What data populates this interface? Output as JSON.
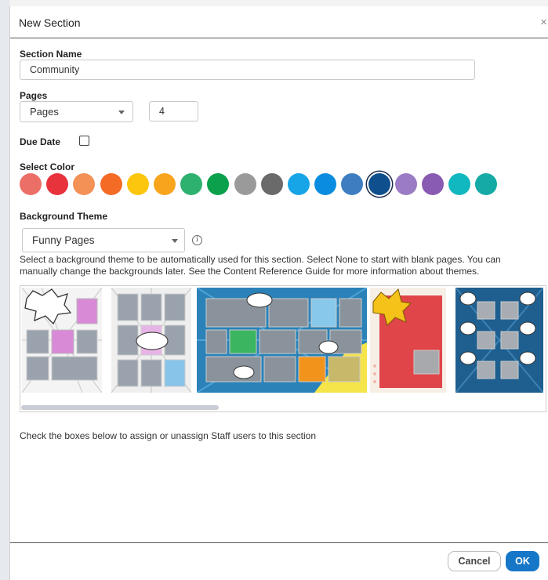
{
  "dialog": {
    "title": "New Section",
    "close_glyph": "×"
  },
  "section_name": {
    "label": "Section Name",
    "value": "Community"
  },
  "pages": {
    "label": "Pages",
    "selected": "Pages",
    "count": "4"
  },
  "due_date": {
    "label": "Due Date",
    "checked": false
  },
  "colors": {
    "label": "Select Color",
    "selected_index": 14,
    "swatches": [
      "#ec6f67",
      "#e8323c",
      "#f49157",
      "#f46b26",
      "#fbc60d",
      "#f8a51d",
      "#2eb16f",
      "#0ba04b",
      "#9a9a9a",
      "#6a6a6a",
      "#17a5e8",
      "#0a8ce0",
      "#3e7ec0",
      "#0f4f8e",
      "#9b7bc4",
      "#8a5bb2",
      "#12b8bf",
      "#16aaa6"
    ]
  },
  "background_theme": {
    "label": "Background Theme",
    "selected": "Funny Pages",
    "info_icon": "info-icon",
    "description": "Select a background theme to be automatically used for this section. Select None to start with blank pages. You can manually change the backgrounds later. See the Content Reference Guide for more information about themes."
  },
  "assign_text": "Check the boxes below to assign or unassign Staff users to this section",
  "footer": {
    "cancel_label": "Cancel",
    "ok_label": "OK"
  }
}
